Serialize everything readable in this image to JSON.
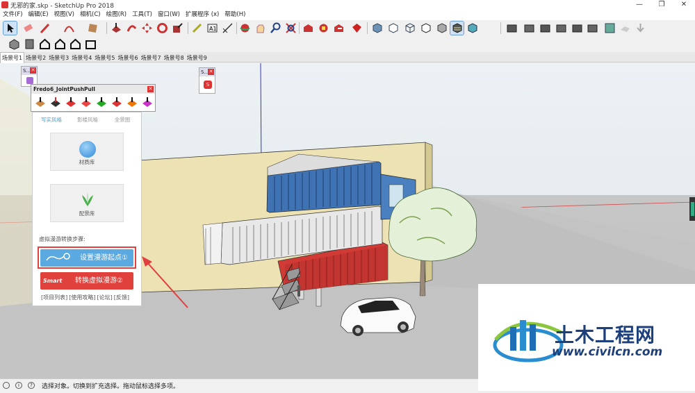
{
  "window": {
    "title": "无邪的家.skp - SketchUp Pro 2018",
    "minimize": "—",
    "maximize": "❐",
    "close": "✕"
  },
  "menu": [
    "文件(F)",
    "编辑(E)",
    "视图(V)",
    "相机(C)",
    "绘图(R)",
    "工具(T)",
    "窗口(W)",
    "扩展程序 (x)",
    "帮助(H)"
  ],
  "scene_tabs": [
    "场景号1",
    "场景号2",
    "场景号3",
    "场景号4",
    "场景号5",
    "场景号6",
    "场景号7",
    "场景号8",
    "场景号9"
  ],
  "panels": {
    "small_left_title": "S...",
    "small_right_title": "S...",
    "fredo_title": "Fredo6_JointPushPull"
  },
  "smart_panel": {
    "tabs": [
      "写实风格",
      "影楼风格",
      "全景图"
    ],
    "card_materials": "材质库",
    "card_plants": "配景库",
    "steps_label": "虚拟漫游转换步骤:",
    "start_button": "设置漫游起点①",
    "convert_badge": "Smart",
    "convert_button": "转换虚拟漫游②",
    "links": [
      "[项目列表]",
      "[使用攻略]",
      "[论坛]",
      "[反馈]"
    ]
  },
  "status": {
    "text": "选择对象。切换到扩充选择。拖动鼠标选择多项。",
    "icon1": "i",
    "icon2": "?"
  },
  "watermark": {
    "brand": "土木工程网",
    "url": "www.civilcn.com"
  },
  "colors": {
    "accent_blue": "#5aa9e0",
    "accent_red": "#e0413d",
    "highlight": "#e04040",
    "container_blue": "#3f73b4",
    "container_red": "#d23b35",
    "container_white": "#e8e8e8"
  }
}
